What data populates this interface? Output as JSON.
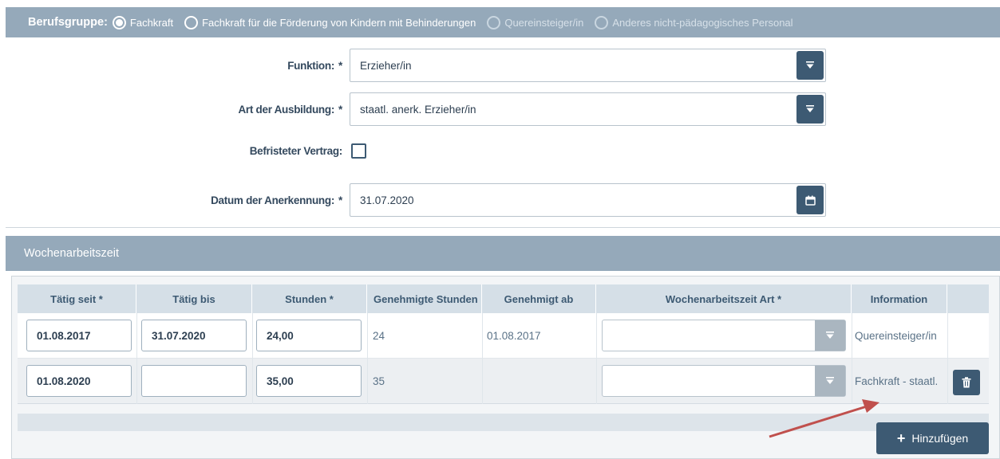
{
  "berufsgruppe": {
    "label": "Berufsgruppe:",
    "options": [
      {
        "label": "Fachkraft",
        "selected": true,
        "disabled": false
      },
      {
        "label": "Fachkraft für die Förderung von Kindern mit Behinderungen",
        "selected": false,
        "disabled": false
      },
      {
        "label": "Quereinsteiger/in",
        "selected": false,
        "disabled": true
      },
      {
        "label": "Anderes nicht-pädagogisches Personal",
        "selected": false,
        "disabled": true
      }
    ]
  },
  "form": {
    "funktion": {
      "label": "Funktion:",
      "required": "*",
      "value": "Erzieher/in"
    },
    "ausbildung": {
      "label": "Art der Ausbildung:",
      "required": "*",
      "value": "staatl. anerk. Erzieher/in"
    },
    "befristet": {
      "label": "Befristeter Vertrag:",
      "checked": false
    },
    "anerkennung": {
      "label": "Datum der Anerkennung:",
      "required": "*",
      "value": "31.07.2020"
    }
  },
  "wochenarbeitszeit": {
    "title": "Wochenarbeitszeit",
    "columns": [
      "Tätig seit *",
      "Tätig bis",
      "Stunden *",
      "Genehmigte Stunden",
      "Genehmigt ab",
      "Wochenarbeitszeit Art *",
      "Information",
      ""
    ],
    "rows": [
      {
        "taetig_seit": "01.08.2017",
        "taetig_bis": "31.07.2020",
        "stunden": "24,00",
        "genehmigte_stunden": "24",
        "genehmigt_ab": "01.08.2017",
        "art": "",
        "information": "Quereinsteiger/in"
      },
      {
        "taetig_seit": "01.08.2020",
        "taetig_bis": "",
        "stunden": "35,00",
        "genehmigte_stunden": "35",
        "genehmigt_ab": "",
        "art": "",
        "information": "Fachkraft - staatl."
      }
    ],
    "add_label": "Hinzufügen"
  },
  "colors": {
    "accent": "#3d5a73",
    "header": "#95a9ba",
    "arrow": "#c0504d"
  }
}
